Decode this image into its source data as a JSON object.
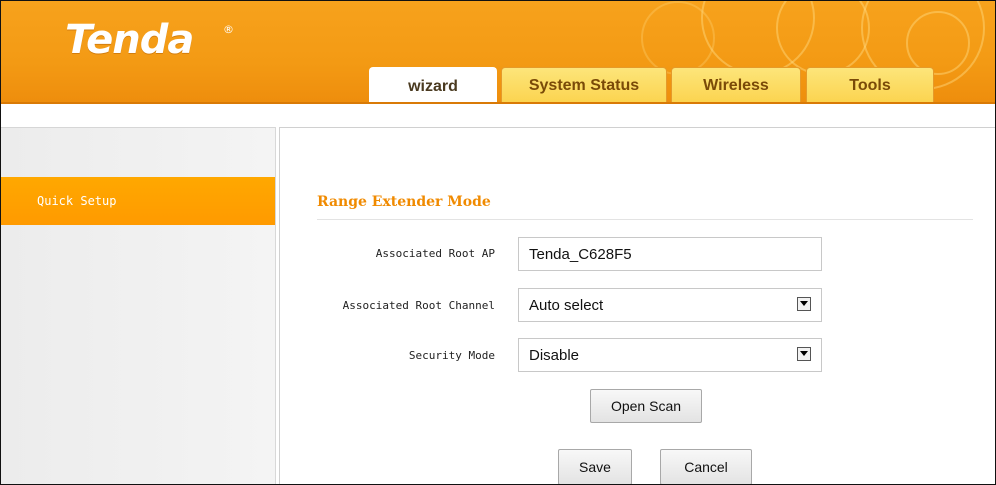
{
  "header": {
    "logo_text": "Tenda",
    "logo_mark": "®",
    "accent_color": "#f39a14"
  },
  "tabs": [
    {
      "label": "wizard",
      "active": true
    },
    {
      "label": "System Status",
      "active": false
    },
    {
      "label": "Wireless",
      "active": false
    },
    {
      "label": "Tools",
      "active": false
    }
  ],
  "sidebar": {
    "items": [
      {
        "label": "Quick Setup",
        "active": true
      }
    ]
  },
  "main": {
    "section_title": "Range Extender Mode",
    "fields": {
      "root_ap": {
        "label": "Associated Root AP",
        "value": "Tenda_C628F5"
      },
      "root_channel": {
        "label": "Associated Root Channel",
        "value": "Auto select"
      },
      "security_mode": {
        "label": "Security Mode",
        "value": "Disable"
      }
    },
    "buttons": {
      "open_scan": "Open Scan",
      "save": "Save",
      "cancel": "Cancel"
    }
  }
}
